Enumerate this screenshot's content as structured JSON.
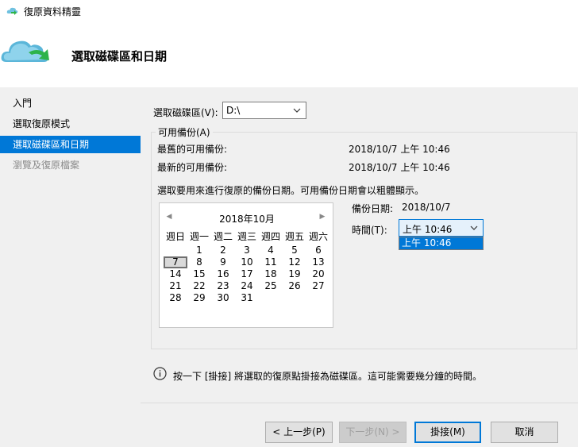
{
  "window": {
    "title": "復原資料精靈"
  },
  "header": {
    "heading": "選取磁碟區和日期"
  },
  "sidebar": {
    "items": [
      {
        "label": "入門",
        "state": "normal"
      },
      {
        "label": "選取復原模式",
        "state": "normal"
      },
      {
        "label": "選取磁碟區和日期",
        "state": "active"
      },
      {
        "label": "瀏覽及復原檔案",
        "state": "disabled"
      }
    ]
  },
  "volume": {
    "label": "選取磁碟區(V):",
    "value": "D:\\"
  },
  "backups": {
    "group_title": "可用備份(A)",
    "oldest_label": "最舊的可用備份:",
    "oldest_value": "2018/10/7 上午 10:46",
    "newest_label": "最新的可用備份:",
    "newest_value": "2018/10/7 上午 10:46",
    "instruction": "選取要用來進行復原的備份日期。可用備份日期會以粗體顯示。"
  },
  "calendar": {
    "month": "2018年10月",
    "weekdays": [
      "週日",
      "週一",
      "週二",
      "週三",
      "週四",
      "週五",
      "週六"
    ],
    "weeks": [
      [
        "",
        "1",
        "2",
        "3",
        "4",
        "5",
        "6"
      ],
      [
        "7",
        "8",
        "9",
        "10",
        "11",
        "12",
        "13"
      ],
      [
        "14",
        "15",
        "16",
        "17",
        "18",
        "19",
        "20"
      ],
      [
        "21",
        "22",
        "23",
        "24",
        "25",
        "26",
        "27"
      ],
      [
        "28",
        "29",
        "30",
        "31",
        "",
        "",
        ""
      ]
    ],
    "selected_day": "7"
  },
  "backup_date": {
    "label": "備份日期:",
    "value": "2018/10/7"
  },
  "time": {
    "label": "時間(T):",
    "value": "上午 10:46",
    "options": [
      "上午 10:46"
    ]
  },
  "info": {
    "text": "按一下 [掛接] 將選取的復原點掛接為磁碟區。這可能需要幾分鐘的時間。"
  },
  "buttons": {
    "back": "< 上一步(P)",
    "next": "下一步(N) >",
    "mount": "掛接(M)",
    "cancel": "取消"
  },
  "colors": {
    "accent": "#0078d7",
    "panel": "#f0f0f0",
    "logo_arrow": "#2db34a"
  }
}
